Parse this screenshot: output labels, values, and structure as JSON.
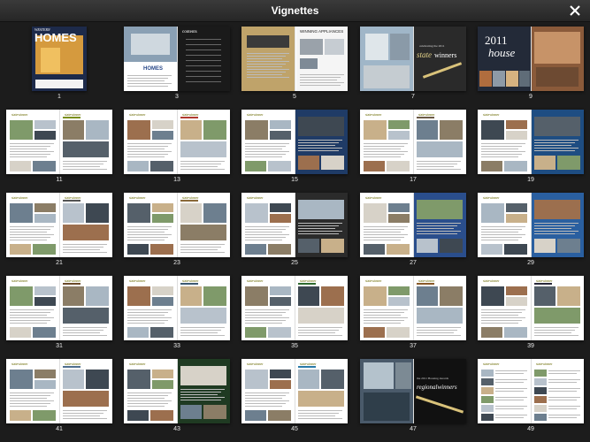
{
  "header": {
    "title": "Vignettes",
    "close_icon": "close-icon"
  },
  "pages": [
    {
      "num": "1",
      "style": "cover",
      "cover_title": "HOMES",
      "cover_kicker": "WESTERN"
    },
    {
      "num": "3",
      "style": "contents",
      "contents_word": "contents",
      "masthead": "HOMES"
    },
    {
      "num": "5",
      "style": "editorial",
      "ad_title": "WINNING APPLIANCES"
    },
    {
      "num": "7",
      "style": "opener",
      "script": "state",
      "bold": "winners",
      "kicker": "celebrating the 2011"
    },
    {
      "num": "9",
      "style": "house",
      "big": "2011",
      "word": "house"
    },
    {
      "num": "11",
      "style": "spread",
      "label": "statewinner",
      "accent": "#7b8f1a"
    },
    {
      "num": "13",
      "style": "spread",
      "label": "statewinner",
      "accent": "#b03a2e"
    },
    {
      "num": "15",
      "style": "spread_ad",
      "label": "statewinner",
      "accent": "#1f3b66"
    },
    {
      "num": "17",
      "style": "spread",
      "label": "statewinner",
      "accent": "#6b5a46"
    },
    {
      "num": "19",
      "style": "spread_ad",
      "label": "statewinner",
      "accent": "#1e4d82"
    },
    {
      "num": "21",
      "style": "spread",
      "label": "statewinner",
      "accent": "#545454"
    },
    {
      "num": "23",
      "style": "spread",
      "label": "statewinner",
      "accent": "#8a6a3a"
    },
    {
      "num": "25",
      "style": "spread_ad",
      "label": "statewinner",
      "accent": "#2b2b2b"
    },
    {
      "num": "27",
      "style": "spread_ad",
      "label": "statewinner",
      "accent": "#2a4e8c"
    },
    {
      "num": "29",
      "style": "spread_ad",
      "label": "statewinner",
      "accent": "#2a5fa0"
    },
    {
      "num": "31",
      "style": "spread",
      "label": "statewinner",
      "accent": "#6a4a2a"
    },
    {
      "num": "33",
      "style": "spread",
      "label": "statewinner",
      "accent": "#3e5a73"
    },
    {
      "num": "35",
      "style": "spread",
      "label": "statewinner",
      "accent": "#2f6a2f"
    },
    {
      "num": "37",
      "style": "spread",
      "label": "statewinner",
      "accent": "#8a5a2a"
    },
    {
      "num": "39",
      "style": "spread",
      "label": "statewinner",
      "accent": "#2a2a3a"
    },
    {
      "num": "41",
      "style": "spread",
      "label": "statewinner",
      "accent": "#4f6f8f"
    },
    {
      "num": "43",
      "style": "spread_ad",
      "label": "statewinner",
      "accent": "#1f3a22"
    },
    {
      "num": "45",
      "style": "spread",
      "label": "statewinner",
      "accent": "#2a7aa8"
    },
    {
      "num": "47",
      "style": "regional",
      "kicker": "the 2011 Housing Awards",
      "title": "regionalwinners"
    },
    {
      "num": "49",
      "style": "list",
      "label": "statewinner",
      "accent": "#6a6a6a"
    }
  ]
}
